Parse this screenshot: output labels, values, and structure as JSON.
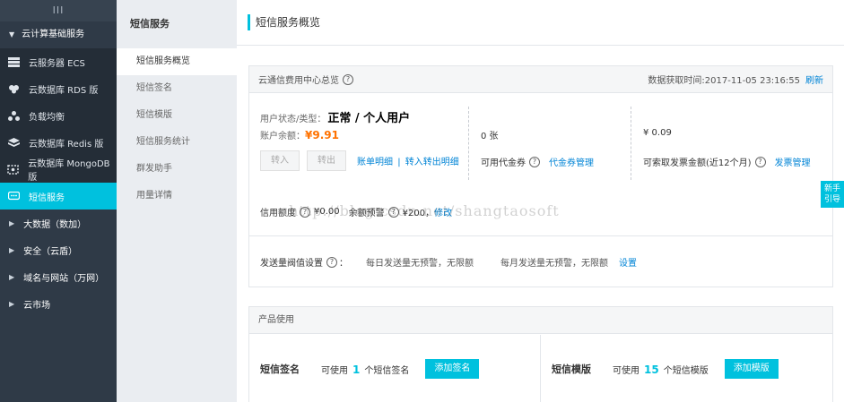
{
  "sidebar": {
    "top_glyph": "III",
    "group_label": "云计算基础服务",
    "items": [
      {
        "label": "云服务器 ECS",
        "icon": "server-icon"
      },
      {
        "label": "云数据库 RDS 版",
        "icon": "database-icon"
      },
      {
        "label": "负载均衡",
        "icon": "load-balancer-icon"
      },
      {
        "label": "云数据库 Redis 版",
        "icon": "redis-icon"
      },
      {
        "label": "云数据库 MongoDB 版",
        "icon": "mongodb-icon"
      },
      {
        "label": "短信服务",
        "icon": "message-icon"
      }
    ],
    "groups2": [
      {
        "label": "大数据（数加）"
      },
      {
        "label": "安全（云盾）"
      },
      {
        "label": "域名与网站（万网）"
      },
      {
        "label": "云市场"
      }
    ]
  },
  "subnav": {
    "title": "短信服务",
    "items": [
      {
        "label": "短信服务概览"
      },
      {
        "label": "短信签名"
      },
      {
        "label": "短信模版"
      },
      {
        "label": "短信服务统计"
      },
      {
        "label": "群发助手"
      },
      {
        "label": "用量详情"
      }
    ]
  },
  "main": {
    "title": "短信服务概览",
    "overview": {
      "head_label": "云通信费用中心总览",
      "fetch_time": "数据获取时间:2017-11-05 23:16:55",
      "refresh": "刷新",
      "status_label": "用户状态/类型：",
      "status_value": "正常 / 个人用户",
      "balance_label": "账户余额：",
      "balance_value": "¥9.91",
      "btn_recharge": "转入",
      "btn_withdraw": "转出",
      "link_bill": "账单明细",
      "link_sep": "|",
      "link_transfer": "转入转出明细",
      "voucher_count": "0 张",
      "voucher_label": "可用代金券",
      "voucher_manage": "代金券管理",
      "invoice_amount": "¥ 0.09",
      "invoice_label": "可索取发票金额(近12个月)",
      "invoice_manage": "发票管理",
      "credit_label": "信用额度",
      "credit_value": "¥0.00",
      "alert_label": "余额预警",
      "alert_value": "¥200，",
      "alert_edit": "修改",
      "threshold_label": "发送量阀值设置",
      "daily_text": "每日发送量无预警，无限额",
      "monthly_text": "每月发送量无预警，无限额",
      "threshold_set": "设置"
    },
    "product": {
      "head_label": "产品使用",
      "sign_name": "短信签名",
      "sign_prefix": "可使用",
      "sign_count": "1",
      "sign_suffix": "个短信签名",
      "sign_btn": "添加签名",
      "tpl_name": "短信模版",
      "tpl_prefix": "可使用",
      "tpl_count": "15",
      "tpl_suffix": "个短信模版",
      "tpl_btn": "添加模版"
    },
    "newbie_line1": "新手",
    "newbie_line2": "引导",
    "watermark": "http://blog.csdn.net/shangtaosoft"
  },
  "colors": {
    "accent": "#00c1de",
    "sidebar_bg": "#2f3a47",
    "balance": "#ff7200",
    "link": "#0084d6"
  }
}
